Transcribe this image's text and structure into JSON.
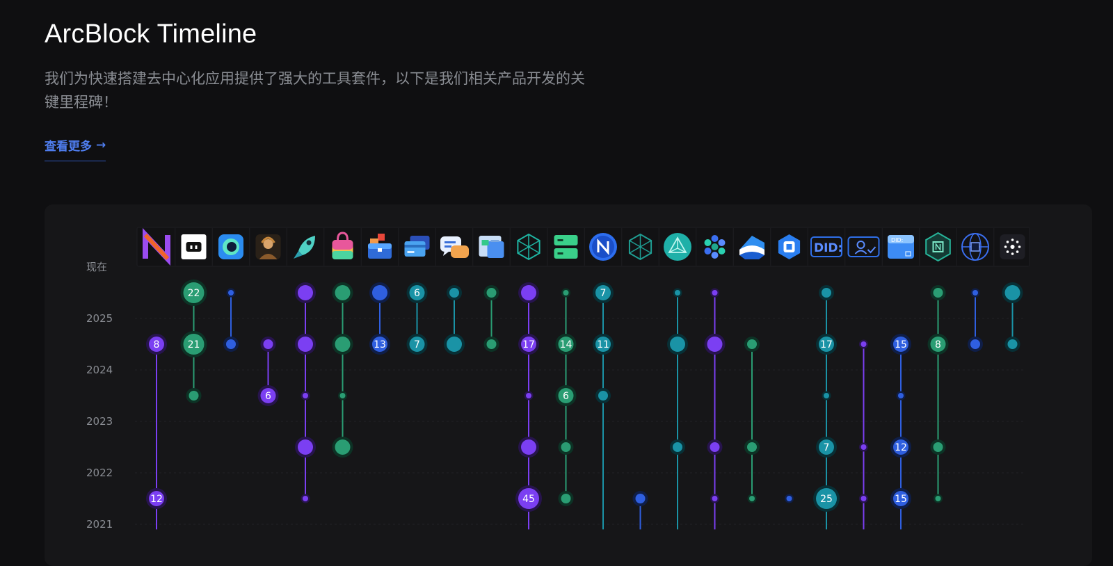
{
  "header": {
    "title": "ArcBlock Timeline",
    "description": "我们为快速搭建去中心化应用提供了强大的工具套件，以下是我们相关产品开发的关键里程碑！",
    "more_label": "查看更多"
  },
  "colors": {
    "purple": "#7b3ff2",
    "green": "#2a9d73",
    "blue": "#2f5fe0",
    "teal": "#1a93a6",
    "background": "#0f0f11",
    "panel": "#161618",
    "link": "#4f7ef0"
  },
  "chart_data": {
    "type": "scatter",
    "y_ticks": [
      "现在",
      "2025",
      "2024",
      "2023",
      "2022",
      "2021"
    ],
    "ylim": [
      2021,
      "现在"
    ],
    "grid": true,
    "products": [
      {
        "icon": "n-logo-icon",
        "color": "purple",
        "line": [
          2024.5,
          2020.9
        ],
        "points": [
          {
            "y": 2024.5,
            "label": "8",
            "size": "m"
          },
          {
            "y": 2021.5,
            "label": "12",
            "size": "m"
          }
        ]
      },
      {
        "icon": "server-box-icon",
        "color": "green",
        "line": [
          2025.5,
          2023.5
        ],
        "points": [
          {
            "y": 2025.5,
            "label": "22",
            "size": "l"
          },
          {
            "y": 2024.5,
            "label": "21",
            "size": "l"
          },
          {
            "y": 2023.5,
            "label": "",
            "size": "s"
          }
        ]
      },
      {
        "icon": "circle-app-icon",
        "color": "blue",
        "line": [
          2025.5,
          2024.5
        ],
        "points": [
          {
            "y": 2025.5,
            "label": "",
            "size": "xs"
          },
          {
            "y": 2024.5,
            "label": "",
            "size": "s"
          }
        ]
      },
      {
        "icon": "avatar-portrait-icon",
        "color": "purple",
        "line": [
          2024.5,
          2023.5
        ],
        "points": [
          {
            "y": 2024.5,
            "label": "",
            "size": "s"
          },
          {
            "y": 2023.5,
            "label": "6",
            "size": "m"
          }
        ]
      },
      {
        "icon": "rocket-icon",
        "color": "purple",
        "line": [
          2025.5,
          2021.5
        ],
        "points": [
          {
            "y": 2025.5,
            "label": "",
            "size": "m"
          },
          {
            "y": 2024.5,
            "label": "",
            "size": "m"
          },
          {
            "y": 2023.5,
            "label": "",
            "size": "xs"
          },
          {
            "y": 2022.5,
            "label": "",
            "size": "m"
          },
          {
            "y": 2021.5,
            "label": "",
            "size": "xs"
          }
        ]
      },
      {
        "icon": "shopping-bag-icon",
        "color": "green",
        "line": [
          2025.5,
          2022.5
        ],
        "points": [
          {
            "y": 2025.5,
            "label": "",
            "size": "m"
          },
          {
            "y": 2024.5,
            "label": "",
            "size": "m"
          },
          {
            "y": 2023.5,
            "label": "",
            "size": "xs"
          },
          {
            "y": 2022.5,
            "label": "",
            "size": "m"
          }
        ]
      },
      {
        "icon": "toolbox-icon",
        "color": "blue",
        "line": [
          2025.5,
          2024.5
        ],
        "points": [
          {
            "y": 2025.5,
            "label": "",
            "size": "m"
          },
          {
            "y": 2024.5,
            "label": "13",
            "size": "m"
          }
        ]
      },
      {
        "icon": "credit-cards-icon",
        "color": "teal",
        "line": [
          2025.5,
          2024.5
        ],
        "points": [
          {
            "y": 2025.5,
            "label": "6",
            "size": "m"
          },
          {
            "y": 2024.5,
            "label": "7",
            "size": "m"
          }
        ]
      },
      {
        "icon": "chat-bubbles-icon",
        "color": "teal",
        "line": [
          2025.5,
          2024.5
        ],
        "points": [
          {
            "y": 2025.5,
            "label": "",
            "size": "s"
          },
          {
            "y": 2024.5,
            "label": "",
            "size": "m"
          }
        ]
      },
      {
        "icon": "document-card-icon",
        "color": "green",
        "line": [
          2025.5,
          2024.5
        ],
        "points": [
          {
            "y": 2025.5,
            "label": "",
            "size": "s"
          },
          {
            "y": 2024.5,
            "label": "",
            "size": "s"
          }
        ]
      },
      {
        "icon": "hexagon-cube-icon",
        "color": "purple",
        "line": [
          2025.5,
          2020.9
        ],
        "points": [
          {
            "y": 2025.5,
            "label": "",
            "size": "m"
          },
          {
            "y": 2024.5,
            "label": "17",
            "size": "m"
          },
          {
            "y": 2023.5,
            "label": "",
            "size": "xs"
          },
          {
            "y": 2022.5,
            "label": "",
            "size": "m"
          },
          {
            "y": 2021.5,
            "label": "45",
            "size": "l"
          }
        ]
      },
      {
        "icon": "server-rack-icon",
        "color": "green",
        "line": [
          2025.5,
          2021.5
        ],
        "points": [
          {
            "y": 2025.5,
            "label": "",
            "size": "xs"
          },
          {
            "y": 2024.5,
            "label": "14",
            "size": "m"
          },
          {
            "y": 2023.5,
            "label": "6",
            "size": "m"
          },
          {
            "y": 2022.5,
            "label": "",
            "size": "s"
          },
          {
            "y": 2021.5,
            "label": "",
            "size": "s"
          }
        ]
      },
      {
        "icon": "n-circle-icon",
        "color": "teal",
        "line": [
          2025.5,
          2020.9
        ],
        "points": [
          {
            "y": 2025.5,
            "label": "7",
            "size": "m"
          },
          {
            "y": 2024.5,
            "label": "11",
            "size": "m"
          },
          {
            "y": 2023.5,
            "label": "",
            "size": "s"
          }
        ]
      },
      {
        "icon": "wireframe-cube-icon",
        "color": "blue",
        "line": [
          2021.5,
          2020.9
        ],
        "points": [
          {
            "y": 2021.5,
            "label": "",
            "size": "s"
          }
        ]
      },
      {
        "icon": "crystal-icon",
        "color": "teal",
        "line": [
          2025.5,
          2020.9
        ],
        "points": [
          {
            "y": 2025.5,
            "label": "",
            "size": "xs"
          },
          {
            "y": 2024.5,
            "label": "",
            "size": "m"
          },
          {
            "y": 2022.5,
            "label": "",
            "size": "s"
          }
        ]
      },
      {
        "icon": "hex-cluster-icon",
        "color": "purple",
        "line": [
          2025.5,
          2020.9
        ],
        "points": [
          {
            "y": 2025.5,
            "label": "",
            "size": "xs"
          },
          {
            "y": 2024.5,
            "label": "",
            "size": "m"
          },
          {
            "y": 2022.5,
            "label": "",
            "size": "s"
          },
          {
            "y": 2021.5,
            "label": "",
            "size": "xs"
          }
        ]
      },
      {
        "icon": "layered-shape-icon",
        "color": "green",
        "line": [
          2024.5,
          2021.5
        ],
        "points": [
          {
            "y": 2024.5,
            "label": "",
            "size": "s"
          },
          {
            "y": 2022.5,
            "label": "",
            "size": "s"
          },
          {
            "y": 2021.5,
            "label": "",
            "size": "xs"
          }
        ]
      },
      {
        "icon": "blue-hexagon-icon",
        "color": "blue",
        "line": [
          2021.5,
          2021.5
        ],
        "points": [
          {
            "y": 2021.5,
            "label": "",
            "size": "xs"
          }
        ]
      },
      {
        "icon": "did-text-icon",
        "color": "teal",
        "line": [
          2025.5,
          2020.9
        ],
        "points": [
          {
            "y": 2025.5,
            "label": "",
            "size": "s"
          },
          {
            "y": 2024.5,
            "label": "17",
            "size": "m"
          },
          {
            "y": 2023.5,
            "label": "",
            "size": "xs"
          },
          {
            "y": 2022.5,
            "label": "7",
            "size": "m"
          },
          {
            "y": 2021.5,
            "label": "25",
            "size": "l"
          }
        ]
      },
      {
        "icon": "user-check-icon",
        "color": "purple",
        "line": [
          2024.5,
          2020.9
        ],
        "points": [
          {
            "y": 2024.5,
            "label": "",
            "size": "xs"
          },
          {
            "y": 2022.5,
            "label": "",
            "size": "xs"
          },
          {
            "y": 2021.5,
            "label": "",
            "size": "xs"
          }
        ]
      },
      {
        "icon": "did-card-icon",
        "color": "blue",
        "line": [
          2024.5,
          2020.9
        ],
        "points": [
          {
            "y": 2024.5,
            "label": "15",
            "size": "m"
          },
          {
            "y": 2023.5,
            "label": "",
            "size": "xs"
          },
          {
            "y": 2022.5,
            "label": "12",
            "size": "m"
          },
          {
            "y": 2021.5,
            "label": "15",
            "size": "m"
          }
        ]
      },
      {
        "icon": "hex-n-icon",
        "color": "green",
        "line": [
          2025.5,
          2021.5
        ],
        "points": [
          {
            "y": 2025.5,
            "label": "",
            "size": "s"
          },
          {
            "y": 2024.5,
            "label": "8",
            "size": "m"
          },
          {
            "y": 2022.5,
            "label": "",
            "size": "s"
          },
          {
            "y": 2021.5,
            "label": "",
            "size": "xs"
          }
        ]
      },
      {
        "icon": "globe-n-icon",
        "color": "blue",
        "line": [
          2025.5,
          2024.5
        ],
        "points": [
          {
            "y": 2025.5,
            "label": "",
            "size": "xs"
          },
          {
            "y": 2024.5,
            "label": "",
            "size": "s"
          }
        ]
      },
      {
        "icon": "dots-star-icon",
        "color": "teal",
        "line": [
          2025.5,
          2024.5
        ],
        "points": [
          {
            "y": 2025.5,
            "label": "",
            "size": "m"
          },
          {
            "y": 2024.5,
            "label": "",
            "size": "s"
          }
        ]
      }
    ]
  }
}
